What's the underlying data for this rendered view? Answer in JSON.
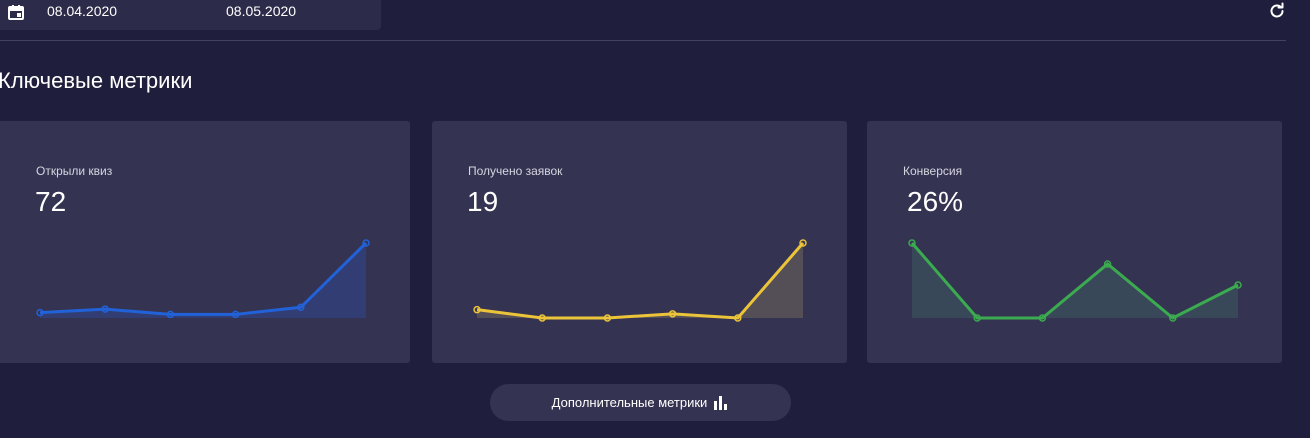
{
  "date_range": {
    "start": "08.04.2020",
    "end": "08.05.2020"
  },
  "section_title": "Ключевые метрики",
  "metrics": [
    {
      "label": "Открыли квиз",
      "value": "72",
      "color": "#2162d8",
      "fill": "#33407a",
      "series": [
        3,
        5,
        2,
        2,
        6,
        42
      ]
    },
    {
      "label": "Получено заявок",
      "value": "19",
      "color": "#ecc43a",
      "fill": "#5b5358",
      "series": [
        2,
        0,
        0,
        1,
        0,
        18
      ]
    },
    {
      "label": "Конверсия",
      "value": "26%",
      "color": "#3bab4f",
      "fill": "#3a4c5b",
      "series": [
        100,
        0,
        0,
        72,
        0,
        44
      ]
    }
  ],
  "more_button": {
    "label": "Дополнительные метрики",
    "icon": "bar-chart-icon"
  },
  "icons": {
    "calendar": "calendar-icon",
    "refresh": "refresh-icon"
  },
  "colors": {
    "background": "#1f1f3d",
    "card": "#343351"
  }
}
